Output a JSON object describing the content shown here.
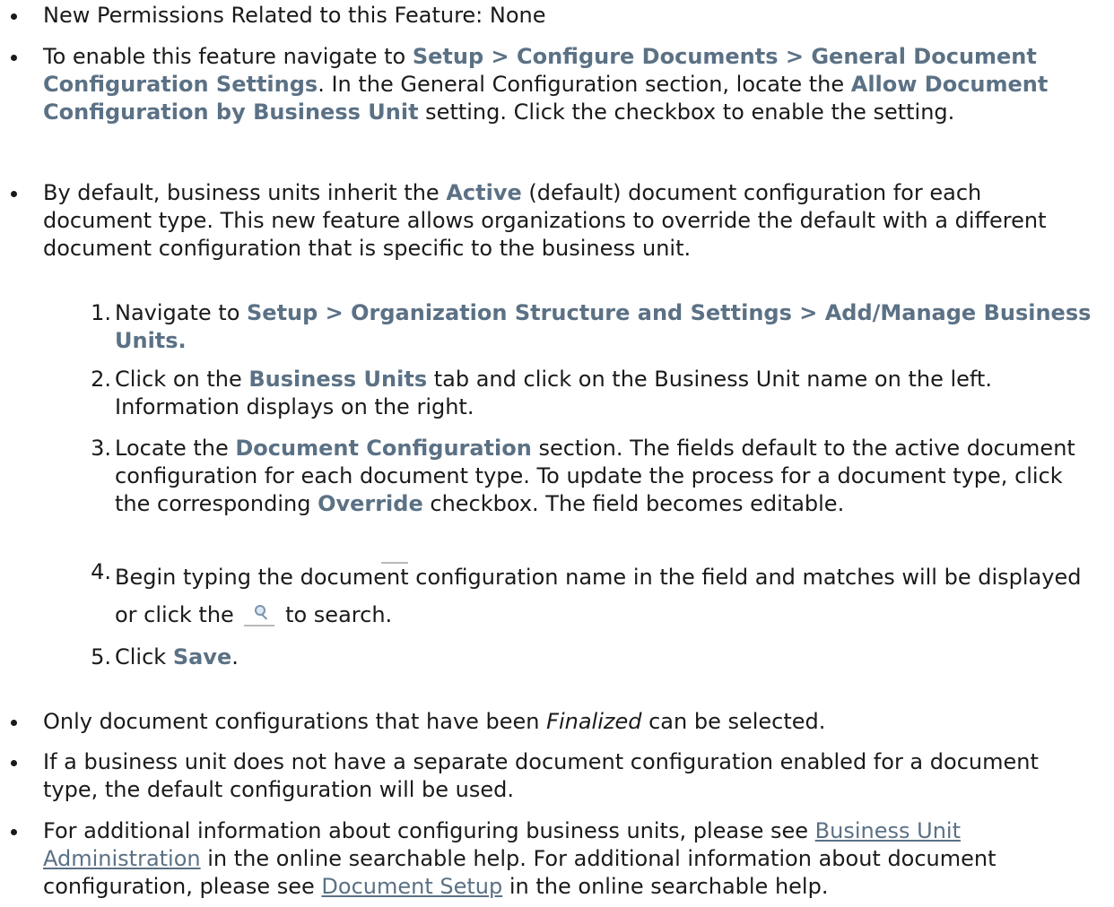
{
  "bullets": {
    "b1": {
      "text": "New Permissions Related to this Feature: None"
    },
    "b2": {
      "t1": "To enable this feature navigate to ",
      "b1": "Setup > Configure Documents > General Document Configuration Settings",
      "t2": ". In the General Configuration section, locate the ",
      "b2": "Allow Document Configuration by Business Unit",
      "t3": " setting. Click the checkbox to enable the setting."
    },
    "b3": {
      "t1": "By default, business units inherit the ",
      "b1": "Active",
      "t2": " (default) document configuration for each document type. This new feature allows organizations to override the default with a different document configuration that is specific to the business unit."
    },
    "b4": {
      "t1": "Only document configurations that have been ",
      "i1": "Finalized",
      "t2": " can be selected."
    },
    "b5": {
      "text": "If a business unit does not have a separate document configuration enabled for a document type, the default configuration will be used."
    },
    "b6": {
      "t1": "For additional information about configuring business units, please see ",
      "l1": "Business Unit Administration",
      "t2": " in the online searchable help. For additional information about document configuration, please see ",
      "l2": "Document Setup",
      "t3": " in the online searchable help."
    }
  },
  "steps": {
    "s1": {
      "num": "1.",
      "t1": "Navigate to ",
      "b1": "Setup > Organization Structure and Settings > Add/Manage Business Units."
    },
    "s2": {
      "num": "2.",
      "t1": "Click on the ",
      "b1": "Business Units",
      "t2": " tab and click on the Business Unit name on the left.  Information displays on the right."
    },
    "s3": {
      "num": "3.",
      "t1": "Locate the ",
      "b1": "Document Configuration",
      "t2": " section. The fields default to the active document configuration for each document type. To update the process for a document type, click the corresponding ",
      "b2": "Override",
      "t3": " checkbox. The field becomes editable."
    },
    "s4": {
      "num": "4.",
      "t1": "Begin typing the document configuration name in the field and matches will be displayed or click the ",
      "icon": "search-icon",
      "t2": " to search."
    },
    "s5": {
      "num": "5.",
      "t1": "Click ",
      "b1": "Save",
      "t2": "."
    }
  }
}
